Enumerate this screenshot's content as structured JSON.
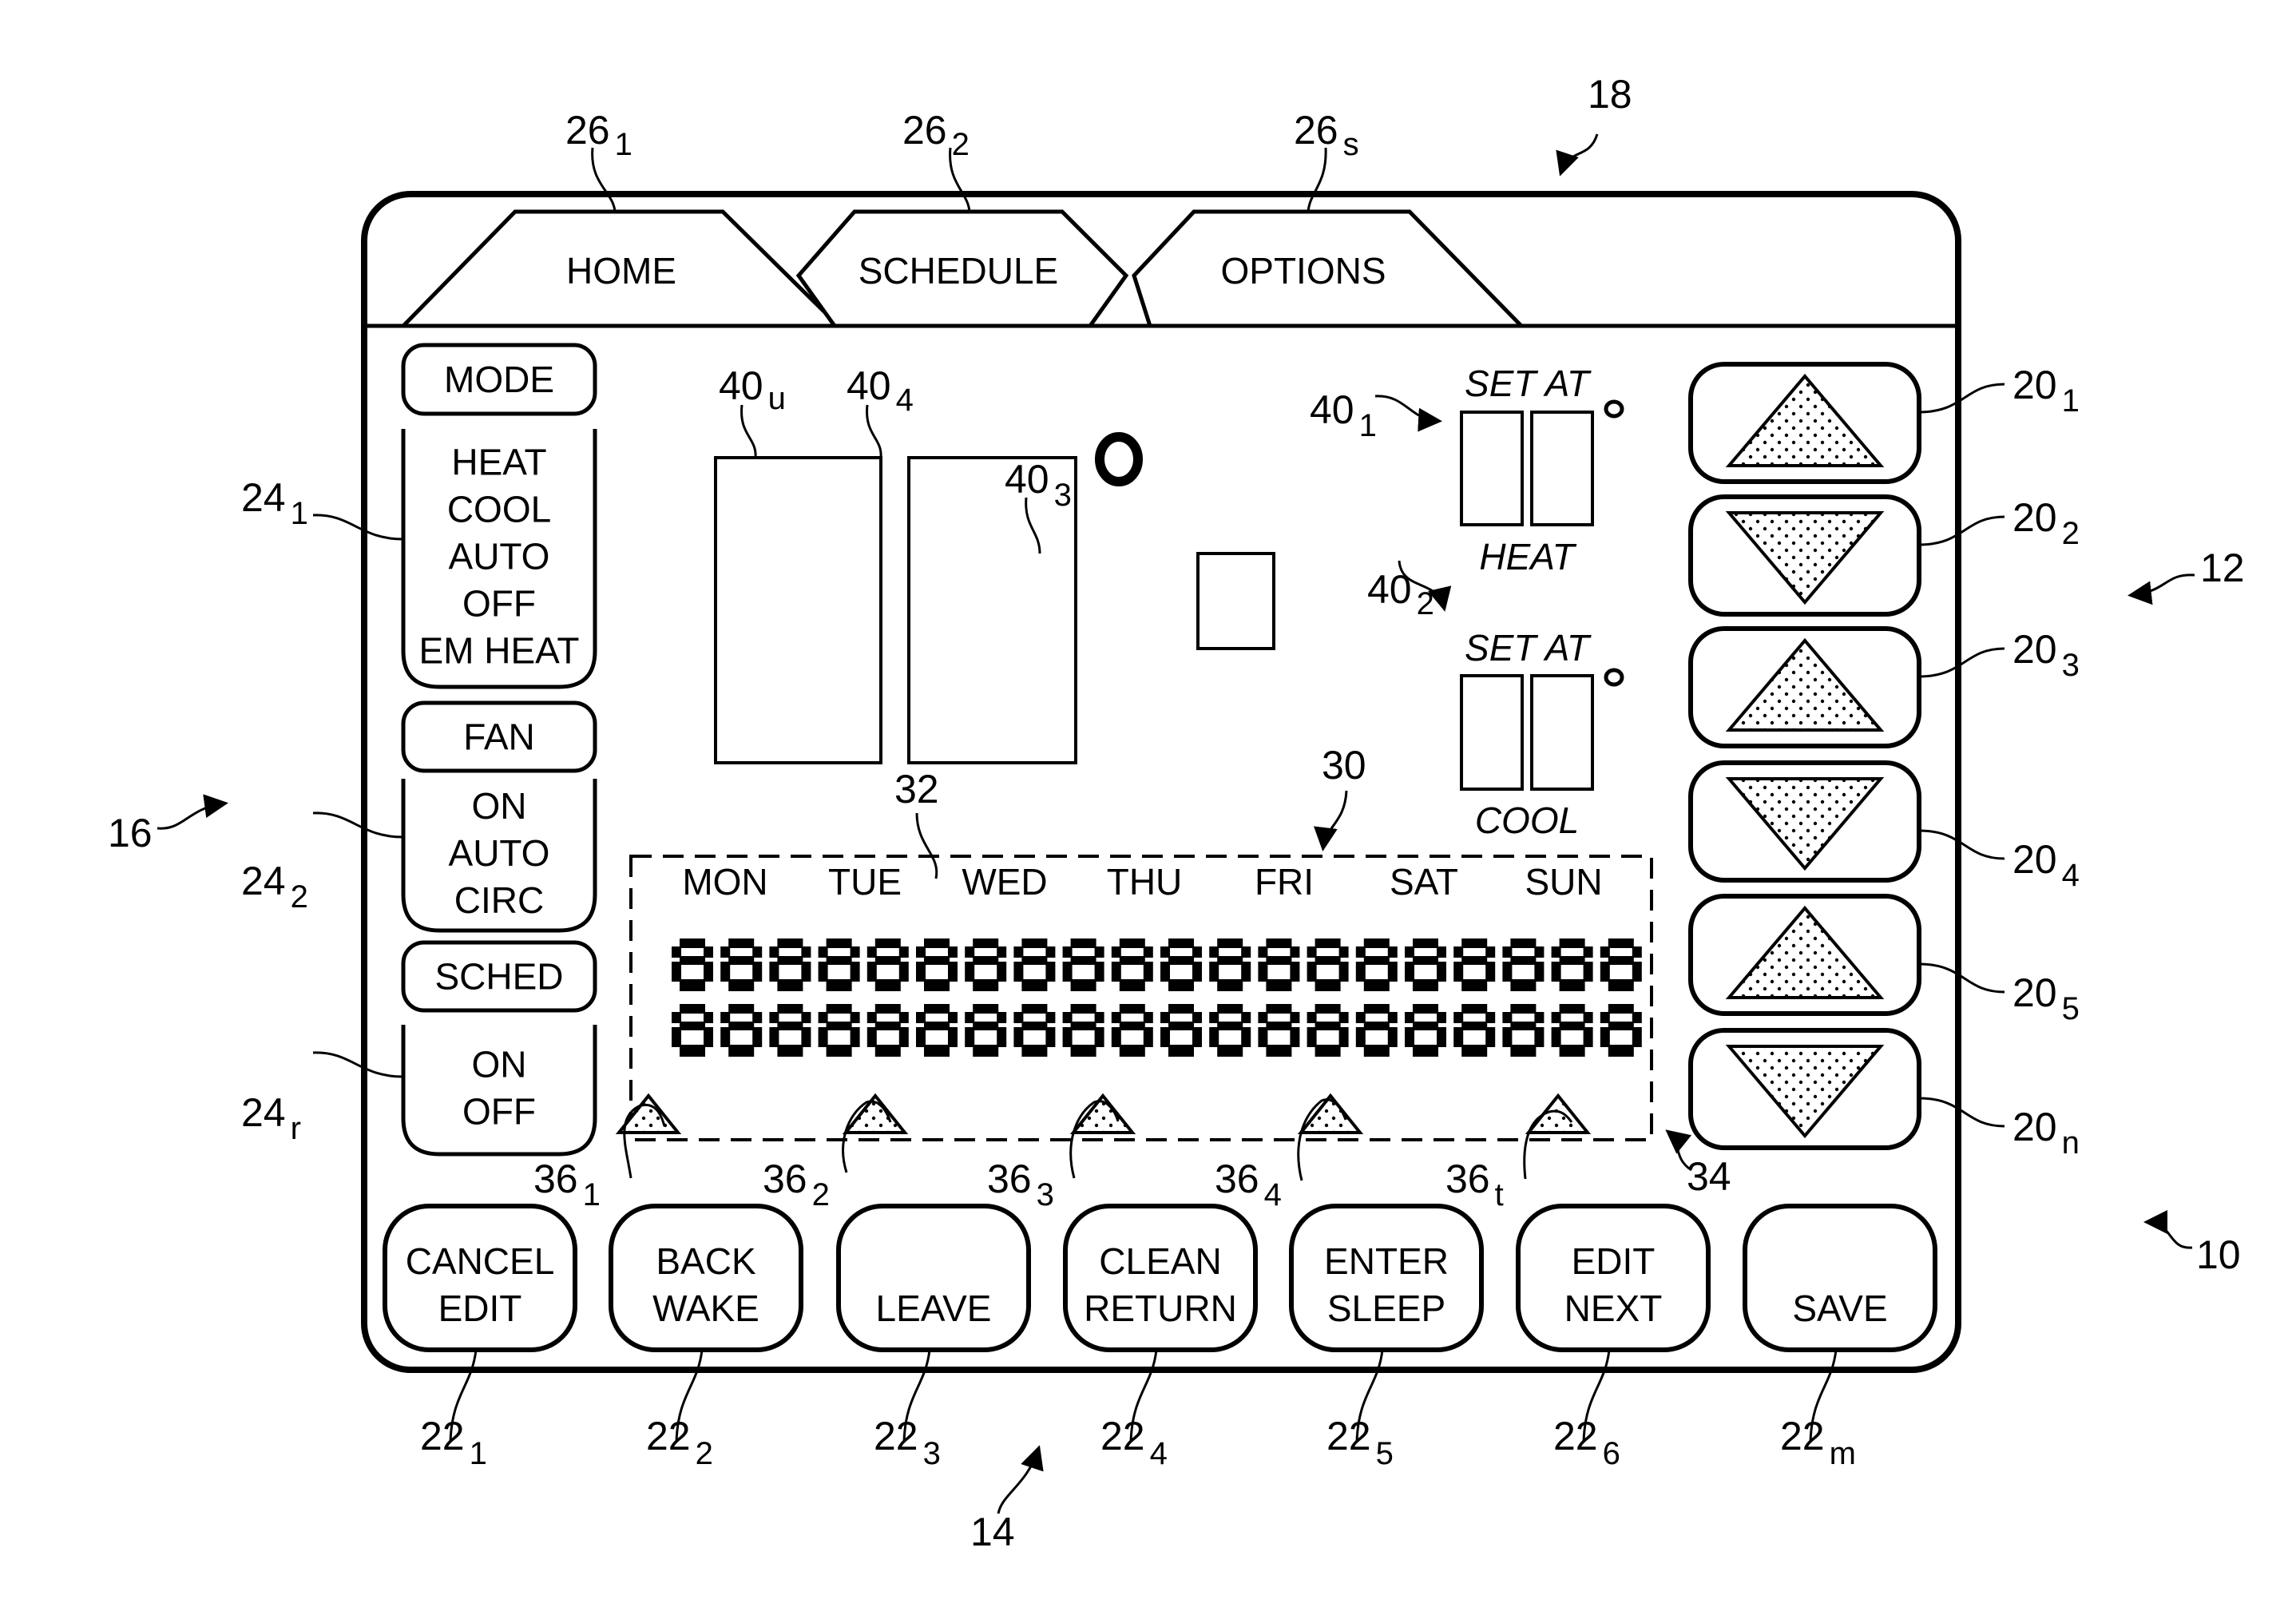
{
  "figure": {
    "reference_numerals": {
      "device": "10",
      "arrow_button_group": "12",
      "bottom_button_group": "14",
      "left_button_group": "16",
      "display": "18",
      "schedule_area": "30",
      "day_labels": "32",
      "time_segment_area": "34"
    }
  },
  "tabs": [
    {
      "label": "HOME",
      "ref": "26",
      "sub": "1"
    },
    {
      "label": "SCHEDULE",
      "ref": "26",
      "sub": "2"
    },
    {
      "label": "OPTIONS",
      "ref": "26",
      "sub": "s"
    }
  ],
  "left_panel": {
    "groups": [
      {
        "header": "MODE",
        "options": [
          "HEAT",
          "COOL",
          "AUTO",
          "OFF",
          "EM HEAT"
        ],
        "ref": "24",
        "sub": "1"
      },
      {
        "header": "FAN",
        "options": [
          "ON",
          "AUTO",
          "CIRC"
        ],
        "ref": "24",
        "sub": "2"
      },
      {
        "header": "SCHED",
        "options": [
          "ON",
          "OFF"
        ],
        "ref": "24",
        "sub": "r"
      }
    ]
  },
  "display_fields": {
    "main_digit_1": {
      "ref": "40",
      "sub": "u"
    },
    "main_digit_2": {
      "ref": "40",
      "sub": "4"
    },
    "small_field": {
      "ref": "40",
      "sub": "3"
    },
    "heat_setpoint": {
      "ref": "40",
      "sub": "1",
      "top_label": "SET AT",
      "bottom_label": "HEAT"
    },
    "cool_setpoint": {
      "ref": "40",
      "sub": "2",
      "top_label": "SET AT",
      "bottom_label": "COOL"
    }
  },
  "schedule": {
    "days": [
      "MON",
      "TUE",
      "WED",
      "THU",
      "FRI",
      "SAT",
      "SUN"
    ],
    "segment_rows": 2,
    "segments_per_row": 20,
    "segment_glyph": "8",
    "markers": [
      {
        "ref": "36",
        "sub": "1"
      },
      {
        "ref": "36",
        "sub": "2"
      },
      {
        "ref": "36",
        "sub": "3"
      },
      {
        "ref": "36",
        "sub": "4"
      },
      {
        "ref": "36",
        "sub": "t"
      }
    ]
  },
  "arrow_buttons": [
    {
      "direction": "up",
      "ref": "20",
      "sub": "1"
    },
    {
      "direction": "down",
      "ref": "20",
      "sub": "2"
    },
    {
      "direction": "up",
      "ref": "20",
      "sub": "3"
    },
    {
      "direction": "down",
      "ref": "20",
      "sub": "4"
    },
    {
      "direction": "up",
      "ref": "20",
      "sub": "5"
    },
    {
      "direction": "down",
      "ref": "20",
      "sub": "n"
    }
  ],
  "bottom_buttons": [
    {
      "line1": "CANCEL",
      "line2": "EDIT",
      "ref": "22",
      "sub": "1"
    },
    {
      "line1": "BACK",
      "line2": "WAKE",
      "ref": "22",
      "sub": "2"
    },
    {
      "line1": "",
      "line2": "LEAVE",
      "ref": "22",
      "sub": "3"
    },
    {
      "line1": "CLEAN",
      "line2": "RETURN",
      "ref": "22",
      "sub": "4"
    },
    {
      "line1": "ENTER",
      "line2": "SLEEP",
      "ref": "22",
      "sub": "5"
    },
    {
      "line1": "EDIT",
      "line2": "NEXT",
      "ref": "22",
      "sub": "6"
    },
    {
      "line1": "",
      "line2": "SAVE",
      "ref": "22",
      "sub": "m"
    }
  ]
}
